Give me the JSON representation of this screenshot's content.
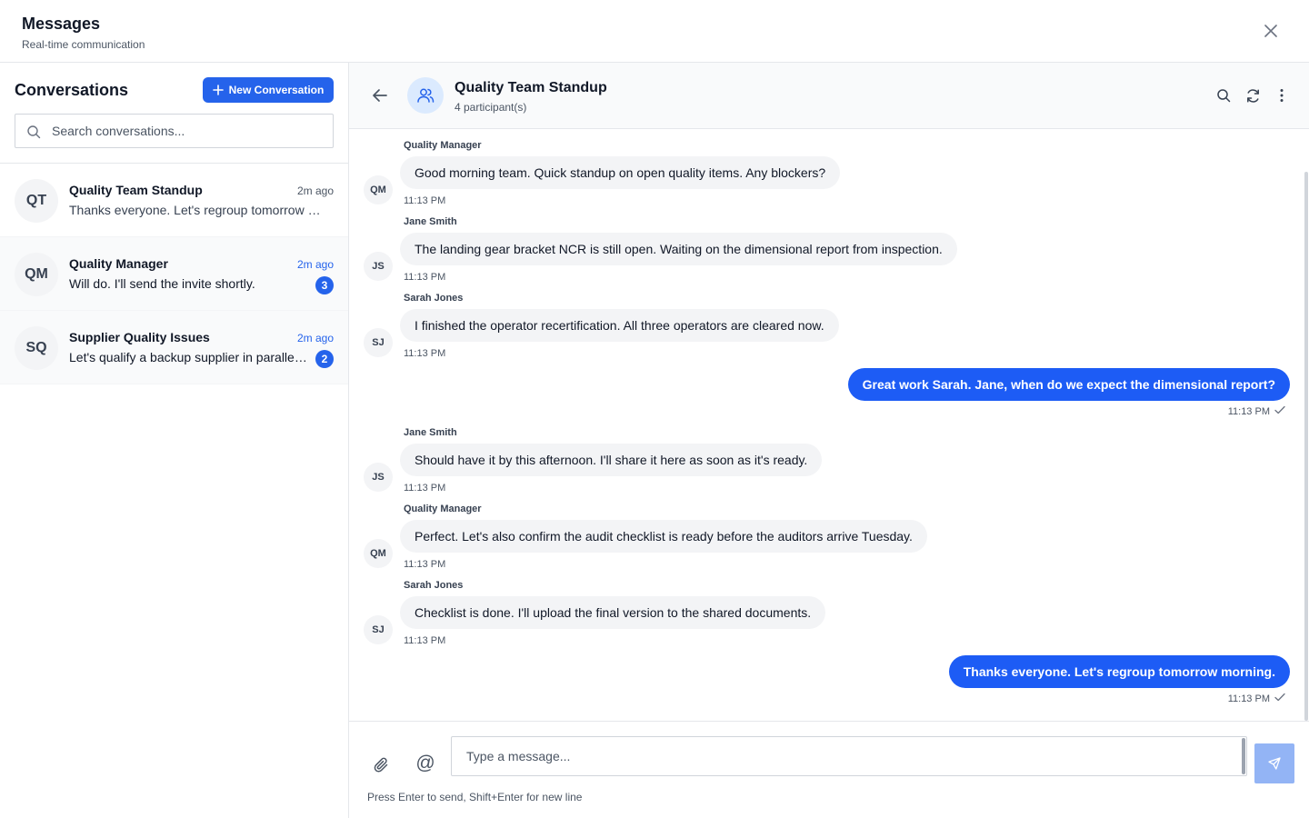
{
  "header": {
    "title": "Messages",
    "subtitle": "Real-time communication"
  },
  "sidebar": {
    "heading": "Conversations",
    "new_button_label": "New Conversation",
    "search_placeholder": "Search conversations...",
    "conversations": [
      {
        "initials": "QT",
        "name": "Quality Team Standup",
        "time": "2m ago",
        "preview": "Thanks everyone. Let's regroup tomorrow morning.",
        "unread": null
      },
      {
        "initials": "QM",
        "name": "Quality Manager",
        "time": "2m ago",
        "preview": "Will do. I'll send the invite shortly.",
        "unread": "3"
      },
      {
        "initials": "SQ",
        "name": "Supplier Quality Issues",
        "time": "2m ago",
        "preview": "Let's qualify a backup supplier in parallel. Can you draft the list?",
        "unread": "2"
      }
    ]
  },
  "chat": {
    "title": "Quality Team Standup",
    "participants": "4 participant(s)",
    "messages": [
      {
        "sender": "Quality Manager",
        "initials": "QM",
        "text": "Good morning team. Quick standup on open quality items. Any blockers?",
        "time": "11:13 PM"
      },
      {
        "sender": "Jane Smith",
        "initials": "JS",
        "text": "The landing gear bracket NCR is still open. Waiting on the dimensional report from inspection.",
        "time": "11:13 PM"
      },
      {
        "sender": "Sarah Jones",
        "initials": "SJ",
        "text": "I finished the operator recertification. All three operators are cleared now.",
        "time": "11:13 PM"
      },
      {
        "text": "Great work Sarah. Jane, when do we expect the dimensional report?",
        "time": "11:13 PM"
      },
      {
        "sender": "Jane Smith",
        "initials": "JS",
        "text": "Should have it by this afternoon. I'll share it here as soon as it's ready.",
        "time": "11:13 PM"
      },
      {
        "sender": "Quality Manager",
        "initials": "QM",
        "text": "Perfect. Let's also confirm the audit checklist is ready before the auditors arrive Tuesday.",
        "time": "11:13 PM"
      },
      {
        "sender": "Sarah Jones",
        "initials": "SJ",
        "text": "Checklist is done. I'll upload the final version to the shared documents.",
        "time": "11:13 PM"
      },
      {
        "text": "Thanks everyone. Let's regroup tomorrow morning.",
        "time": "11:13 PM"
      }
    ]
  },
  "composer": {
    "placeholder": "Type a message...",
    "mention_symbol": "@",
    "hint": "Press Enter to send, Shift+Enter for new line"
  },
  "colors": {
    "accent": "#2563eb",
    "outgoing_bubble": "#1d5cf5",
    "incoming_bubble": "#f3f4f6",
    "send_button": "#93b4f5"
  }
}
